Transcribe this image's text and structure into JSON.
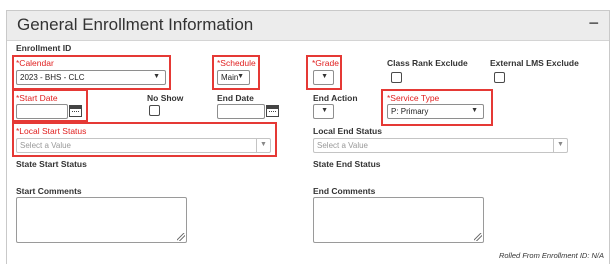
{
  "section": {
    "title": "General Enrollment Information",
    "collapse_symbol": "−"
  },
  "enrollment_id": {
    "label": "Enrollment ID"
  },
  "calendar": {
    "label": "*Calendar",
    "value": "2023 - BHS - CLC"
  },
  "schedule": {
    "label": "*Schedule",
    "value": "Main"
  },
  "grade": {
    "label": "*Grade",
    "value": ""
  },
  "class_rank_exclude": {
    "label": "Class Rank Exclude",
    "checked": false
  },
  "external_lms_exclude": {
    "label": "External LMS Exclude",
    "checked": false
  },
  "start_date": {
    "label": "*Start Date",
    "value": ""
  },
  "no_show": {
    "label": "No Show",
    "checked": false
  },
  "end_date": {
    "label": "End Date",
    "value": ""
  },
  "end_action": {
    "label": "End Action",
    "value": ""
  },
  "service_type": {
    "label": "*Service Type",
    "value": "P: Primary"
  },
  "local_start_status": {
    "label": "*Local Start Status",
    "placeholder": "Select a Value"
  },
  "local_end_status": {
    "label": "Local End Status",
    "placeholder": "Select a Value"
  },
  "state_start_status": {
    "label": "State Start Status"
  },
  "state_end_status": {
    "label": "State End Status"
  },
  "start_comments": {
    "label": "Start Comments"
  },
  "end_comments": {
    "label": "End Comments"
  },
  "footer": {
    "rolled_from": "Rolled From Enrollment ID: N/A"
  },
  "colors": {
    "required": "#e01e1e",
    "highlight": "#e53935",
    "header_bg": "#ececec"
  },
  "icons": {
    "dropdown": "caret-down-icon",
    "calendar": "calendar-icon",
    "resize": "resize-grip-icon"
  }
}
